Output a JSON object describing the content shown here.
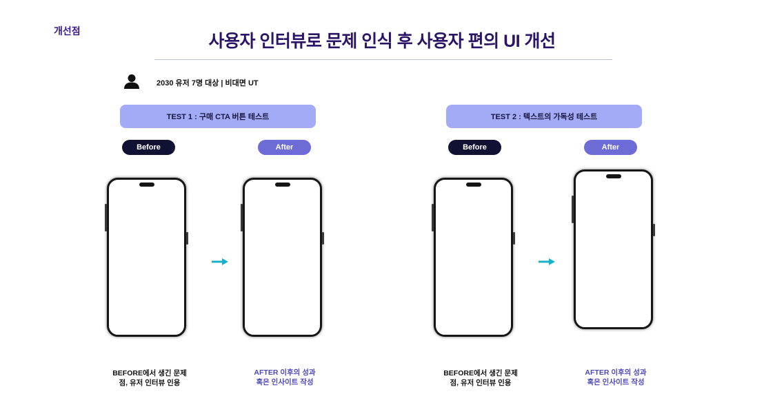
{
  "section_label": "개선점",
  "title": "사용자 인터뷰로 문제 인식 후 사용자 편의 UI 개선",
  "participants": "2030 유저 7명 대상 | 비대면 UT",
  "tests": [
    {
      "header": "TEST 1 : 구매 CTA 버튼 테스트",
      "before_label": "Before",
      "after_label": "After",
      "before_caption_line1": "BEFORE에서 생긴 문제",
      "before_caption_line2": "점, 유저 인터뷰 인용",
      "after_caption_line1": "AFTER 이후의 성과",
      "after_caption_line2": "혹은 인사이트 작성"
    },
    {
      "header": "TEST 2 : 텍스트의 가독성 테스트",
      "before_label": "Before",
      "after_label": "After",
      "before_caption_line1": "BEFORE에서 생긴 문제",
      "before_caption_line2": "점, 유저 인터뷰 인용",
      "after_caption_line1": "AFTER 이후의 성과",
      "after_caption_line2": "혹은 인사이트 작성"
    }
  ],
  "icons": {
    "user": "user-icon",
    "arrow": "arrow-right-icon"
  },
  "colors": {
    "title": "#2b1466",
    "header_bg": "#a3abf6",
    "before_pill": "#111133",
    "after_pill": "#6d6bd6",
    "arrow": "#1ab0c8"
  }
}
